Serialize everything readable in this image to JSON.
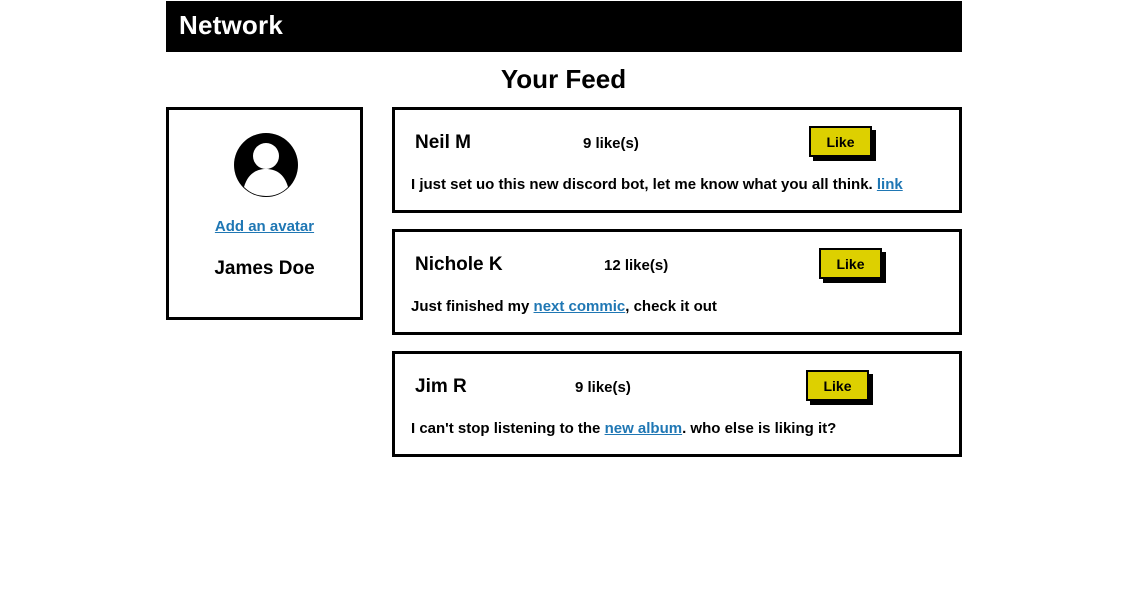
{
  "header": {
    "brand": "Network"
  },
  "feed": {
    "title": "Your Feed"
  },
  "profile": {
    "avatar_link": "Add an avatar",
    "name": "James Doe",
    "avatar_icon": "user-avatar-icon"
  },
  "posts": [
    {
      "author": "Neil M",
      "likes": "9 like(s)",
      "like_label": "Like",
      "body_before": "I just set uo this new discord bot, let me know what you all think.",
      "link_text": "link",
      "body_after": ""
    },
    {
      "author": "Nichole K",
      "likes": "12 like(s)",
      "like_label": "Like",
      "body_before": "Just finished my",
      "link_text": "next commic",
      "body_after": ", check it out"
    },
    {
      "author": "Jim R",
      "likes": "9 like(s)",
      "like_label": "Like",
      "body_before": "I can't stop listening to the",
      "link_text": "new album",
      "body_after": ". who else is liking it?"
    }
  ],
  "colors": {
    "header_background": "#000000",
    "like_button": "#ddd000",
    "link": "#1f77b4"
  }
}
